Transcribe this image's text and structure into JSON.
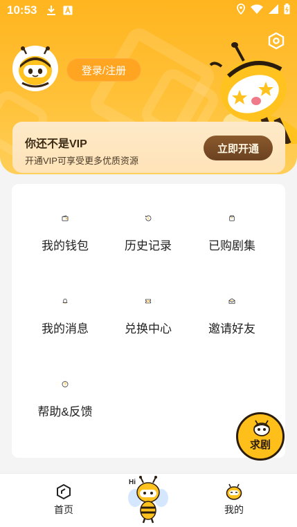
{
  "status_bar": {
    "time": "10:53",
    "left_icons": [
      "download-icon",
      "app-a-icon"
    ],
    "right_icons": [
      "location-icon",
      "wifi-icon",
      "signal-icon",
      "battery-icon"
    ]
  },
  "header": {
    "login_label": "登录/注册",
    "settings_icon": "settings-hex-icon",
    "colors": {
      "bg": "#ffb51f",
      "login_bg": "#ffa521"
    }
  },
  "vip": {
    "title": "你还不是VIP",
    "subtitle": "开通VIP可享受更多优质资源",
    "button_label": "立即开通"
  },
  "menu": {
    "items": [
      {
        "label": "我的钱包",
        "icon": "wallet-icon"
      },
      {
        "label": "历史记录",
        "icon": "history-icon"
      },
      {
        "label": "已购剧集",
        "icon": "purchased-box-icon"
      },
      {
        "label": "我的消息",
        "icon": "bell-icon"
      },
      {
        "label": "兑换中心",
        "icon": "exchange-ticket-icon"
      },
      {
        "label": "邀请好友",
        "icon": "invite-envelope-icon"
      },
      {
        "label": "帮助&反馈",
        "icon": "help-question-icon"
      }
    ]
  },
  "floating": {
    "label": "求剧"
  },
  "tabbar": {
    "tabs": [
      {
        "label": "首页",
        "icon": "home-hex-icon"
      },
      {
        "label": "",
        "icon": "bee-mascot-icon",
        "badge": "Hi"
      },
      {
        "label": "我的",
        "icon": "bee-face-icon"
      }
    ]
  }
}
